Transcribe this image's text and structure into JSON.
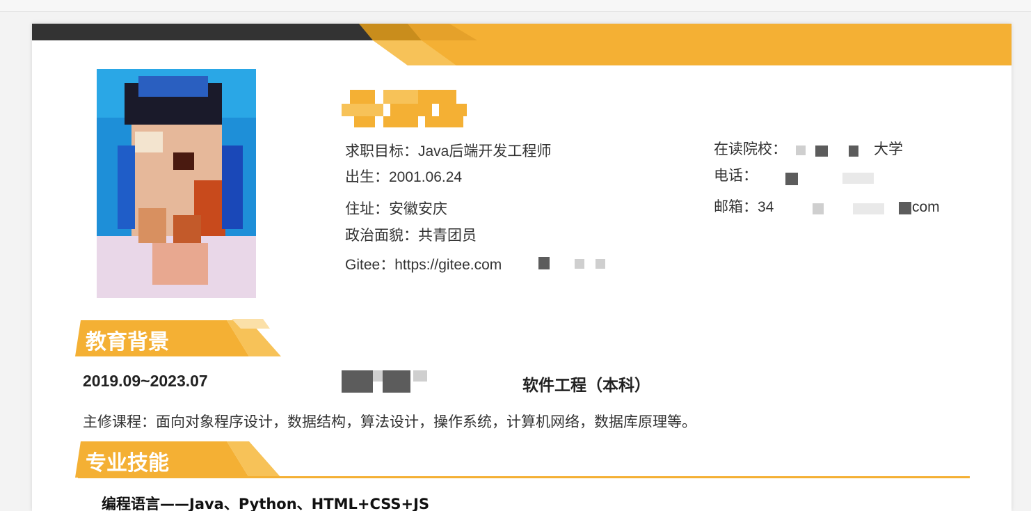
{
  "profile": {
    "job_target": "求职目标：Java后端开发工程师",
    "birth": "出生：2001.06.24",
    "address": "住址：安徽安庆",
    "political": "政治面貌：共青团员",
    "gitee": "Gitee：https://gitee.com",
    "school": "在读院校：",
    "school_suffix": "大学",
    "phone": "电话：",
    "email_prefix": "邮箱：34",
    "email_suffix": "com"
  },
  "education": {
    "title": "教育背景",
    "period": "2019.09~2023.07",
    "major": "软件工程（本科）",
    "courses": "主修课程：面向对象程序设计，数据结构，算法设计，操作系统，计算机网络，数据库原理等。"
  },
  "skills": {
    "title": "专业技能",
    "items": [
      "编程语言——Java、Python、HTML+CSS+JS"
    ]
  },
  "colors": {
    "accent": "#f4b034",
    "dark": "#333333",
    "text": "#333333"
  }
}
